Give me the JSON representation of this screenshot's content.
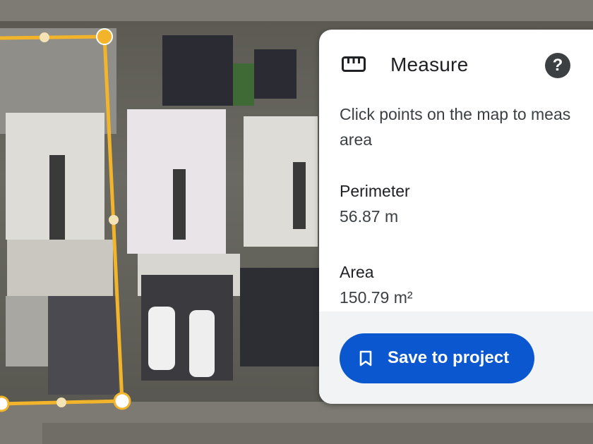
{
  "panel": {
    "title": "Measure",
    "instruction": "Click points on the map to meas\narea",
    "perimeter_label": "Perimeter",
    "perimeter_value": "56.87 m",
    "area_label": "Area",
    "area_value": "150.79 m²",
    "save_label": "Save to project",
    "help_glyph": "?"
  },
  "icons": {
    "title_icon": "ruler-icon",
    "help_icon": "help-icon",
    "save_icon": "bookmark-icon"
  },
  "colors": {
    "accent": "#0b57d0",
    "polygon": "#f2b42a",
    "panel_bg": "#ffffff"
  }
}
